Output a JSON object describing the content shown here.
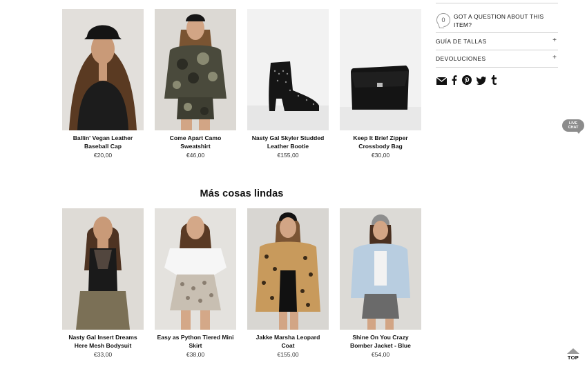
{
  "row1": [
    {
      "name": "Ballin' Vegan Leather Baseball Cap",
      "price": "€20,00"
    },
    {
      "name": "Come Apart Camo Sweatshirt",
      "price": "€46,00"
    },
    {
      "name": "Nasty Gal Skyler Studded Leather Bootie",
      "price": "€155,00"
    },
    {
      "name": "Keep It Brief Zipper Crossbody Bag",
      "price": "€30,00"
    }
  ],
  "more_title": "Más cosas lindas",
  "row2": [
    {
      "name": "Nasty Gal Insert Dreams Here Mesh Bodysuit",
      "price": "€33,00"
    },
    {
      "name": "Easy as Python Tiered Mini Skirt",
      "price": "€38,00"
    },
    {
      "name": "Jakke Marsha Leopard Coat",
      "price": "€155,00"
    },
    {
      "name": "Shine On You Crazy Bomber Jacket - Blue",
      "price": "€54,00"
    }
  ],
  "sidebar": {
    "question_count": "0",
    "question_text": "GOT A QUESTION ABOUT THIS ITEM?",
    "accordions": [
      {
        "label": "GUÍA DE TALLAS",
        "icon": "+"
      },
      {
        "label": "DEVOLUCIONES",
        "icon": "+"
      }
    ],
    "share_icons": [
      "email-icon",
      "facebook-icon",
      "pinterest-icon",
      "twitter-icon",
      "tumblr-icon"
    ]
  },
  "live_chat": {
    "line1": "LIVE",
    "line2": "CHAT"
  },
  "top_label": "TOP"
}
